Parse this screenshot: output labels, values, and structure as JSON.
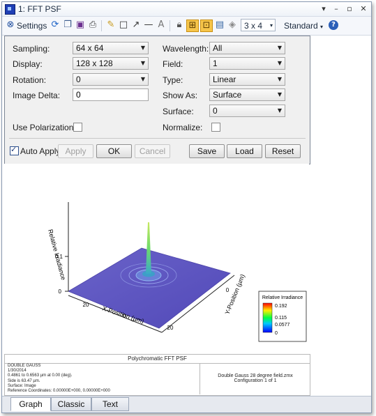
{
  "window": {
    "title": "1: FFT PSF"
  },
  "toolbar": {
    "settings_label": "Settings",
    "layout_combo": "3 x 4",
    "standard_label": "Standard"
  },
  "settings": {
    "sampling_label": "Sampling:",
    "sampling_value": "64 x 64",
    "display_label": "Display:",
    "display_value": "128 x 128",
    "rotation_label": "Rotation:",
    "rotation_value": "0",
    "image_delta_label": "Image Delta:",
    "image_delta_value": "0",
    "wavelength_label": "Wavelength:",
    "wavelength_value": "All",
    "field_label": "Field:",
    "field_value": "1",
    "type_label": "Type:",
    "type_value": "Linear",
    "show_as_label": "Show As:",
    "show_as_value": "Surface",
    "surface_label": "Surface:",
    "surface_value": "0",
    "use_polarization_label": "Use Polarization:",
    "normalize_label": "Normalize:",
    "auto_apply_label": "Auto Apply",
    "apply_label": "Apply",
    "ok_label": "OK",
    "cancel_label": "Cancel",
    "save_label": "Save",
    "load_label": "Load",
    "reset_label": "Reset"
  },
  "plot": {
    "z_axis_label": "Relative Irradiance",
    "x_axis_label": "X-Position (µm)",
    "y_axis_label": "Y-Position (µm)",
    "z_tick_0": "0",
    "z_tick_1": "0.1",
    "x_tick_20a": "20",
    "x_tick_0": "0",
    "x_tick_20b": "20",
    "y_tick_0": "0",
    "legend_title": "Relative Irradiance",
    "legend_max": "0.192",
    "legend_mid": "0.115",
    "legend_low": "0.0577",
    "legend_min": "0"
  },
  "info": {
    "title": "Polychromatic FFT PSF",
    "line1": "DOUBLE GAUSS",
    "line2": "1/30/2014",
    "line3": "0.4861 to 0.6563 µm at 0.00 (deg).",
    "line4": "Side is 63.47 µm.",
    "line5": "Surface: Image",
    "line6": "Reference Coordinates: 0.00000E+000, 0.00000E+000",
    "right1": "Double Gauss 28 degree field.zmx",
    "right2": "Configuration 1 of 1"
  },
  "tabs": {
    "graph": "Graph",
    "classic": "Classic",
    "text": "Text"
  }
}
